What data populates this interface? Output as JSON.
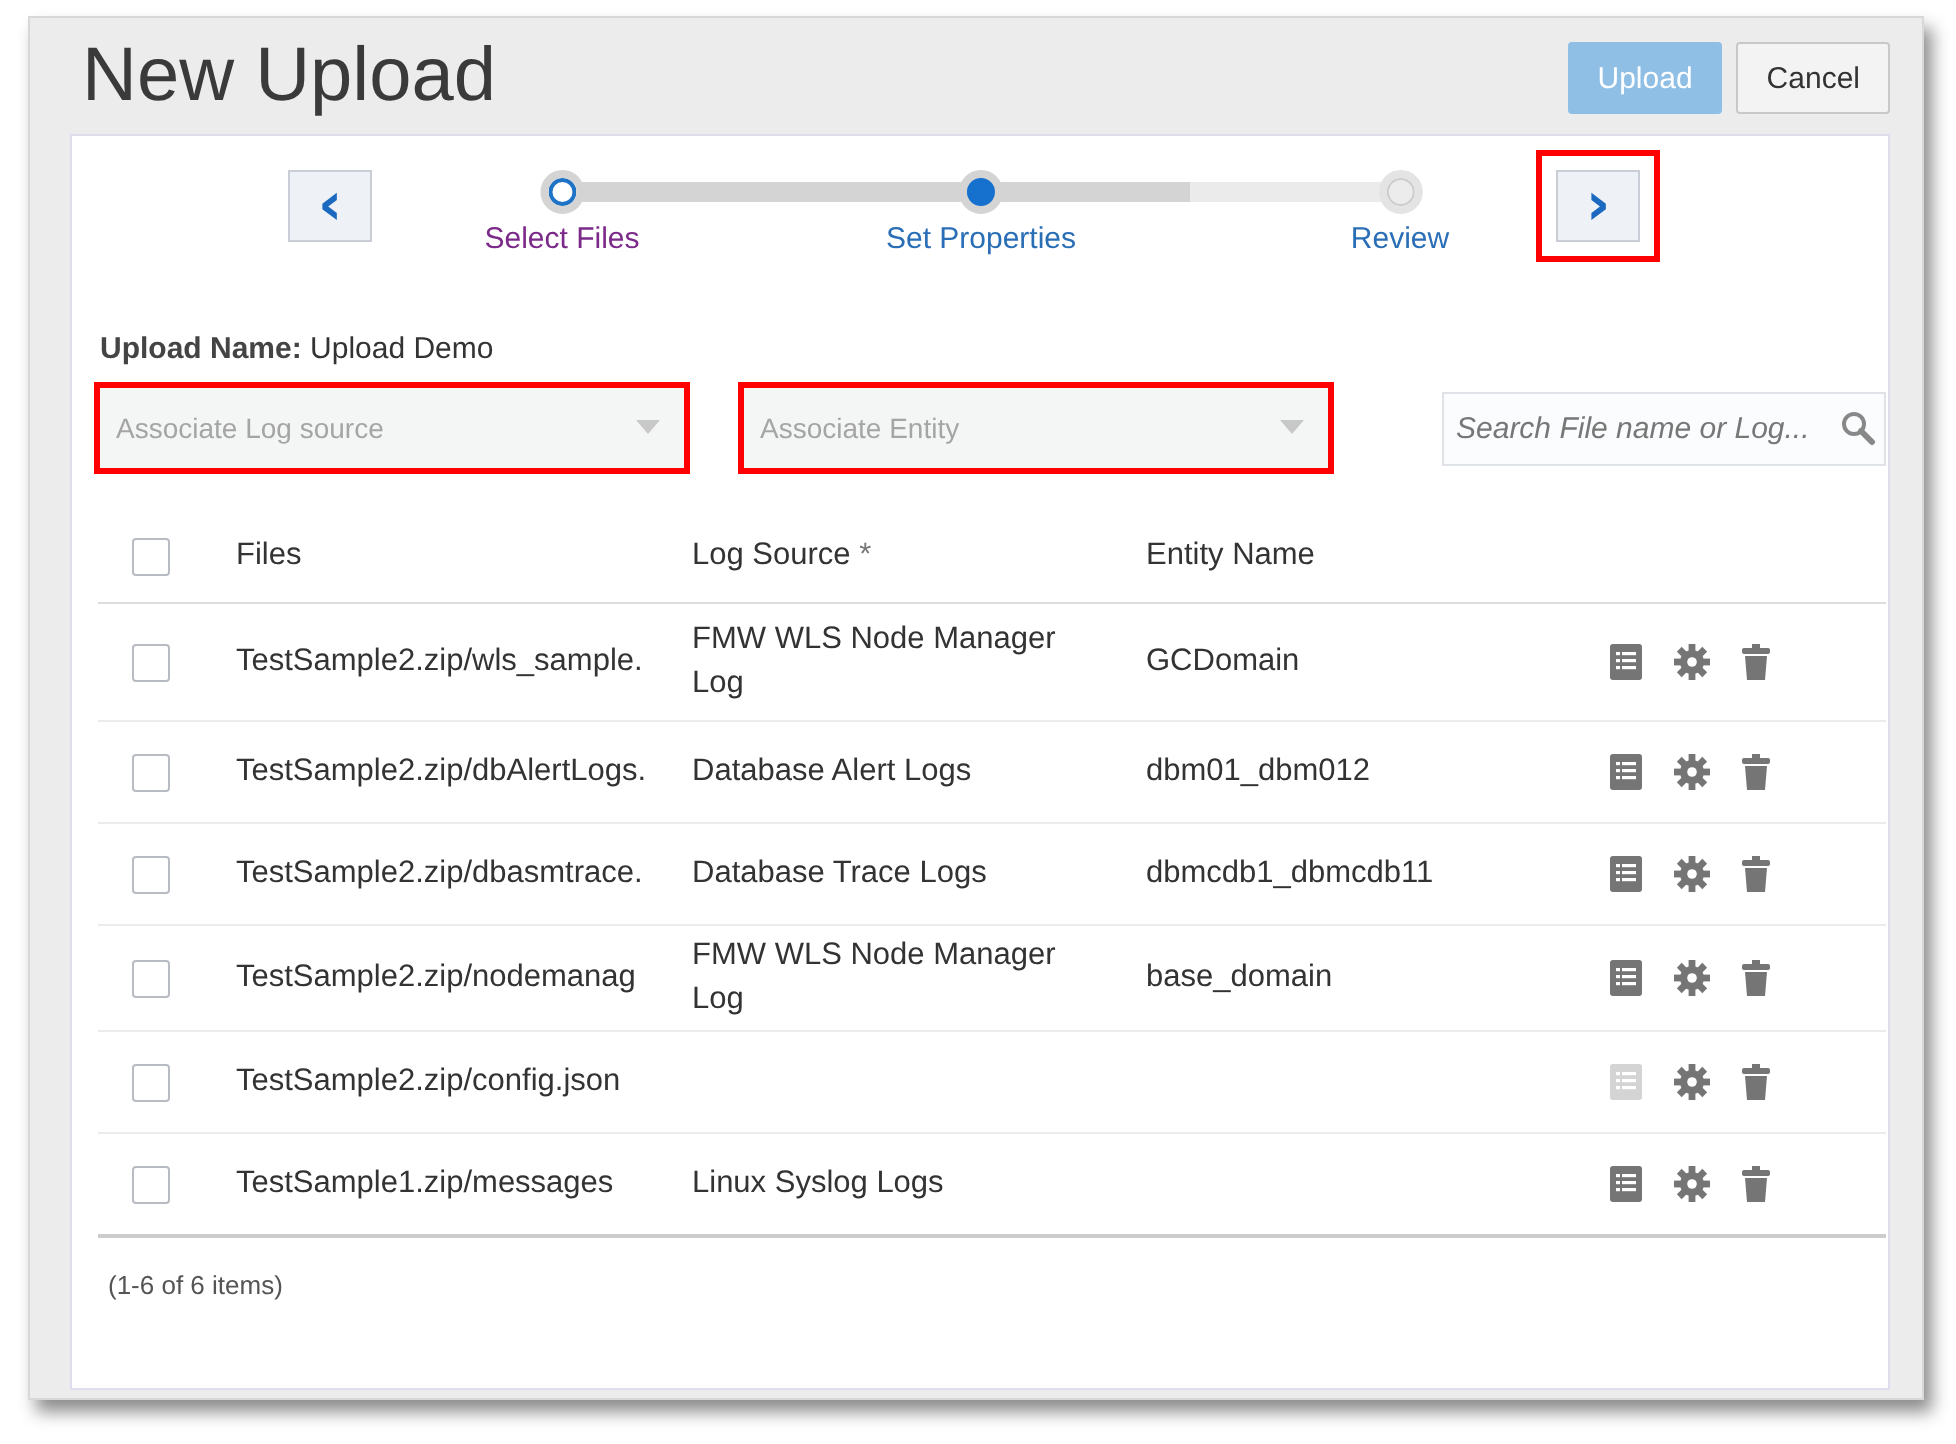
{
  "dialog": {
    "title": "New Upload",
    "buttons": [
      {
        "label": "Upload",
        "kind": "primary",
        "disabled": true
      },
      {
        "label": "Cancel",
        "kind": "secondary",
        "disabled": false
      }
    ]
  },
  "train": {
    "back": {
      "icon": "‹"
    },
    "next": {
      "icon": "›",
      "highlighted": true
    },
    "steps": [
      {
        "label": "Select Files",
        "visited": true,
        "selected": false
      },
      {
        "label": "Set Properties",
        "visited": false,
        "selected": true
      },
      {
        "label": "Review",
        "visited": false,
        "selected": false
      }
    ]
  },
  "upload_name": {
    "label": "Upload Name:",
    "value": "Upload Demo"
  },
  "filters": [
    {
      "placeholder": "Associate Log source",
      "highlighted": true
    },
    {
      "placeholder": "Associate Entity",
      "highlighted": true
    }
  ],
  "search": {
    "placeholder": "Search File name or Log..."
  },
  "table": {
    "columns": [
      "Files",
      "Log Source",
      "Entity Name"
    ],
    "required_mark": "*",
    "select_all_checked": false,
    "rows": [
      {
        "checked": false,
        "file": "TestSample2.zip/wls_sample.",
        "log_source": "FMW WLS Node Manager Log",
        "entity": "GCDomain",
        "details_disabled": false
      },
      {
        "checked": false,
        "file": "TestSample2.zip/dbAlertLogs.",
        "log_source": "Database Alert Logs",
        "entity": "dbm01_dbm012",
        "details_disabled": false
      },
      {
        "checked": false,
        "file": "TestSample2.zip/dbasmtrace.",
        "log_source": "Database Trace Logs",
        "entity": "dbmcdb1_dbmcdb11",
        "details_disabled": false
      },
      {
        "checked": false,
        "file": "TestSample2.zip/nodemanag",
        "log_source": "FMW WLS Node Manager Log",
        "entity": "base_domain",
        "details_disabled": false
      },
      {
        "checked": false,
        "file": "TestSample2.zip/config.json",
        "details_disabled": true
      },
      {
        "checked": false,
        "file": "TestSample1.zip/messages",
        "log_source": "Linux Syslog Logs",
        "details_disabled": false
      }
    ]
  },
  "footer": "(1-6 of 6 items)"
}
